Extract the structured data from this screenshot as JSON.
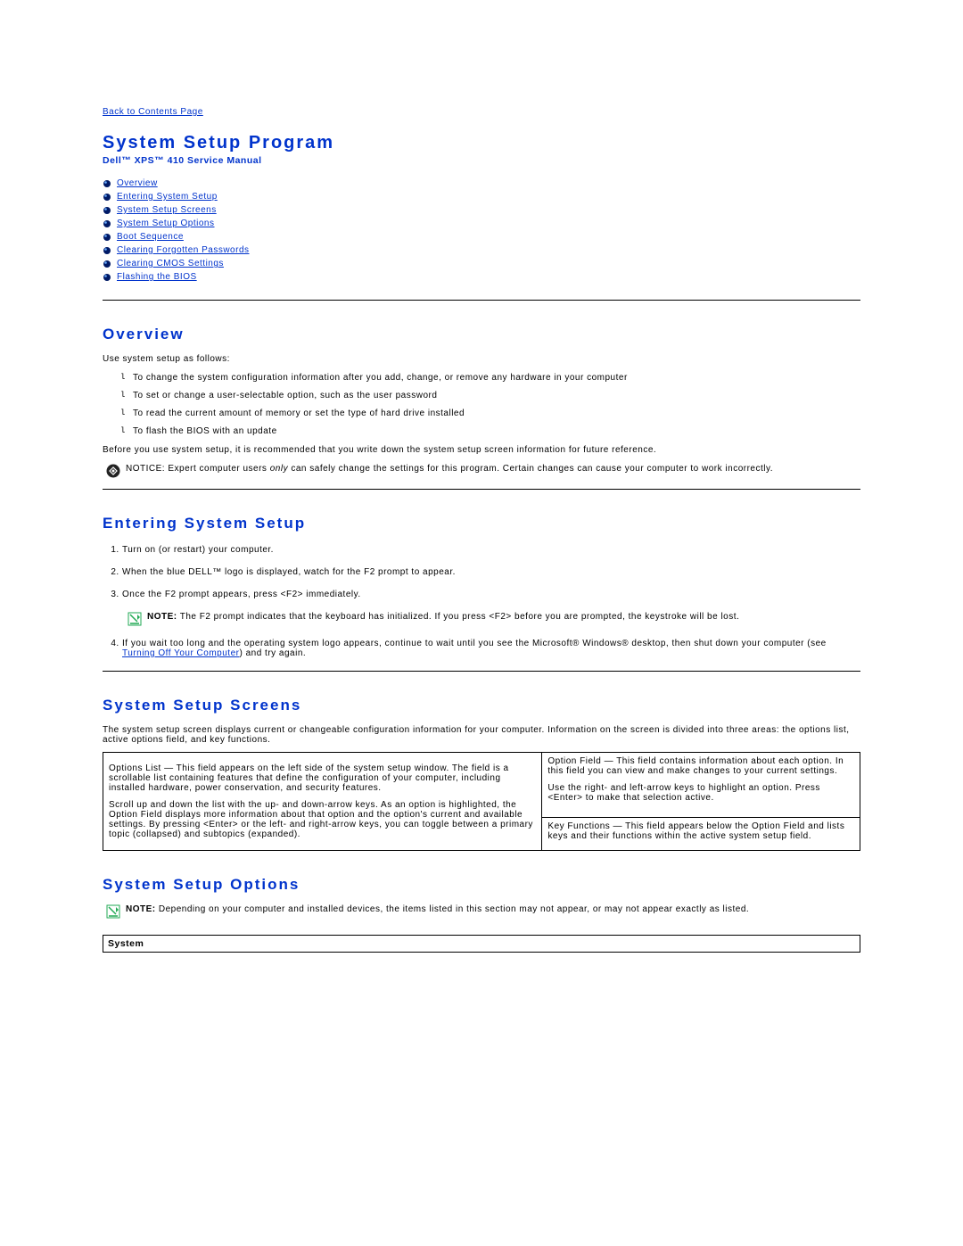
{
  "back_link": "Back to Contents Page",
  "title": "System Setup Program",
  "subtitle": "Dell™ XPS™ 410 Service Manual",
  "toc": [
    "Overview",
    "Entering System Setup",
    "System Setup Screens",
    "System Setup Options",
    "Boot Sequence",
    "Clearing Forgotten Passwords",
    "Clearing CMOS Settings",
    "Flashing the BIOS"
  ],
  "overview": {
    "heading": "Overview",
    "intro": "Use system setup as follows:",
    "bullets": [
      "To change the system configuration information after you add, change, or remove any hardware in your computer",
      "To set or change a user-selectable option, such as the user password",
      "To read the current amount of memory or set the type of hard drive installed",
      "To flash the BIOS with an update"
    ],
    "rec": "Before you use system setup, it is recommended that you write down the system setup screen information for future reference.",
    "notice_label": "NOTICE:",
    "notice_pre": " Expert computer users ",
    "notice_only": "only",
    "notice_post": " can safely change the settings for this program. Certain changes can cause your computer to work incorrectly."
  },
  "entering": {
    "heading": "Entering System Setup",
    "step1": "Turn on (or restart) your computer.",
    "step2": "When the blue DELL™ logo is displayed, watch for the F2 prompt to appear.",
    "step3": "Once the F2 prompt appears, press <F2> immediately.",
    "note_label": "NOTE:",
    "note_text": " The F2 prompt indicates that the keyboard has initialized. If you press <F2> before you are prompted, the keystroke will be lost.",
    "step4_pre": "If you wait too long and the operating system logo appears, continue to wait until you see the Microsoft® Windows® desktop, then shut down your computer (see ",
    "step4_link": "Turning Off Your Computer",
    "step4_post": ") and try again."
  },
  "screens": {
    "heading": "System Setup Screens",
    "intro": "The system setup screen displays current or changeable configuration information for your computer. Information on the screen is divided into three areas: the options list, active options field, and key functions.",
    "left_p1": "Options List — This field appears on the left side of the system setup window. The field is a scrollable list containing features that define the configuration of your computer, including installed hardware, power conservation, and security features.",
    "left_p2": "Scroll up and down the list with the up- and down-arrow keys. As an option is highlighted, the Option Field displays more information about that option and the option's current and available settings. By pressing <Enter> or the left- and right-arrow keys, you can toggle between a primary topic (collapsed) and subtopics (expanded).",
    "right1_p1": "Option Field — This field contains information about each option. In this field you can view and make changes to your current settings.",
    "right1_p2": "Use the right- and left-arrow keys to highlight an option. Press <Enter> to make that selection active.",
    "right2": "Key Functions — This field appears below the Option Field and lists keys and their functions within the active system setup field."
  },
  "options": {
    "heading": "System Setup Options",
    "note_label": "NOTE:",
    "note_text": " Depending on your computer and installed devices, the items listed in this section may not appear, or may not appear exactly as listed.",
    "row1": "System"
  }
}
